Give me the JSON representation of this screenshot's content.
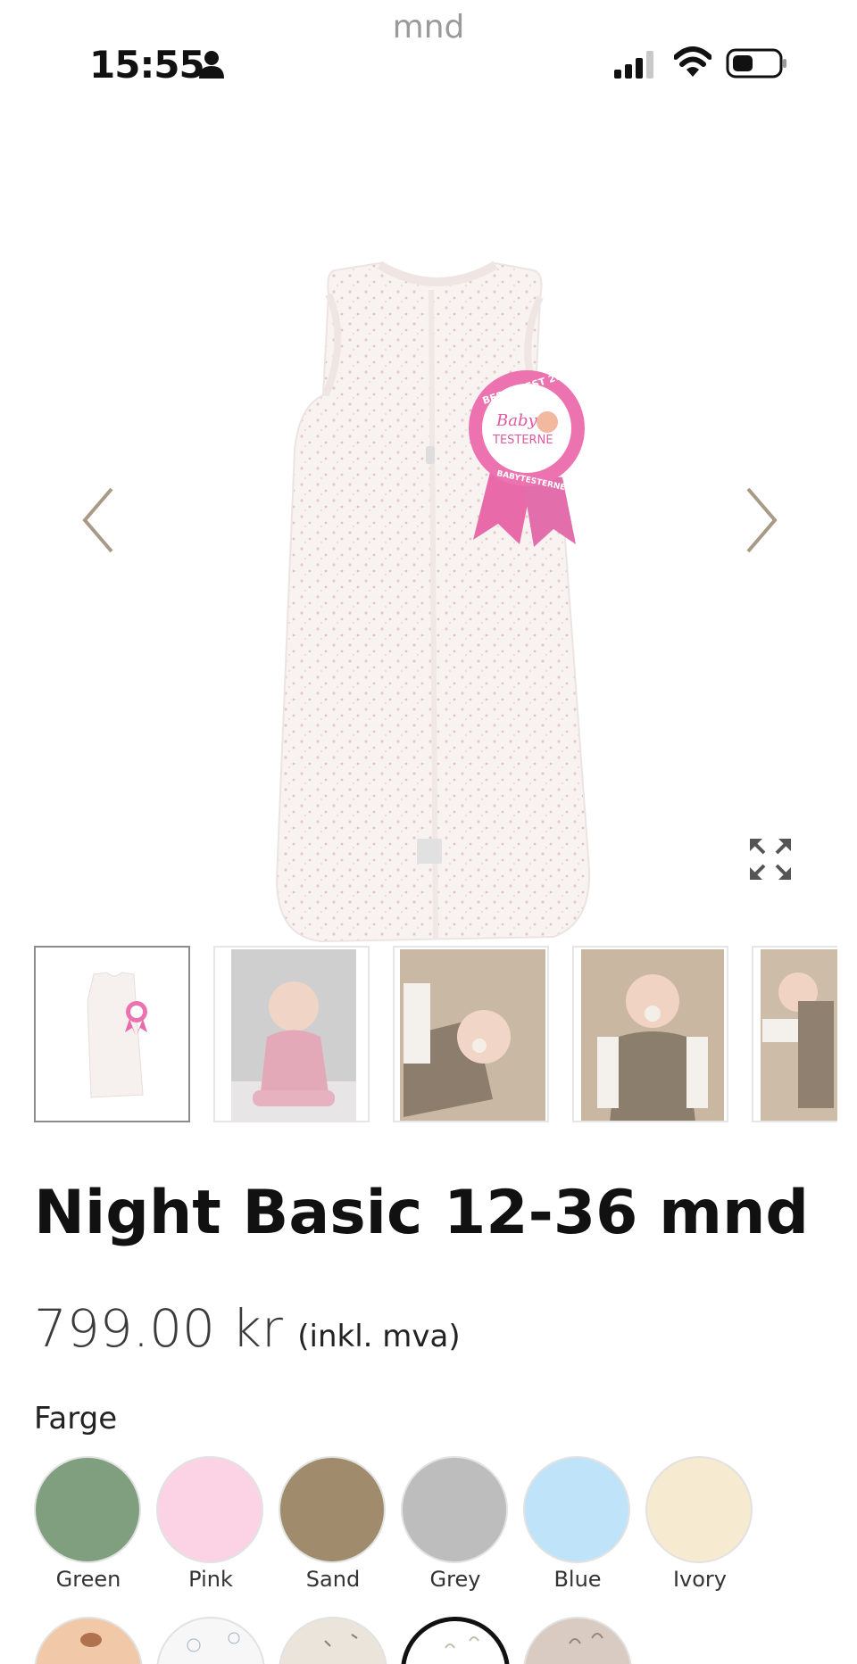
{
  "status_bar": {
    "url": "mnd",
    "time": "15:55"
  },
  "badge": {
    "top_text": "BEST I TEST 2021",
    "brand_line1": "Baby",
    "brand_line2": "TESTERNE",
    "bottom_text": "BABYTESTERNE.NO"
  },
  "product": {
    "title": "Night Basic 12-36 mnd",
    "price": "799.00 kr",
    "vat_note": "(inkl. mva)"
  },
  "color_selector": {
    "label": "Farge",
    "options": [
      {
        "name": "Green",
        "color": "#7f9f7e"
      },
      {
        "name": "Pink",
        "color": "#fbd3e4"
      },
      {
        "name": "Sand",
        "color": "#a08b6d"
      },
      {
        "name": "Grey",
        "color": "#bdbdbd"
      },
      {
        "name": "Blue",
        "color": "#bfe4f9"
      },
      {
        "name": "Ivory",
        "color": "#f6ead1"
      }
    ]
  },
  "patterns": [
    {
      "color": "#f1c9a9"
    },
    {
      "color": "#f7f7f7"
    },
    {
      "color": "#ebe4da"
    },
    {
      "color": "#ffffff"
    },
    {
      "color": "#d9cbc1"
    }
  ]
}
